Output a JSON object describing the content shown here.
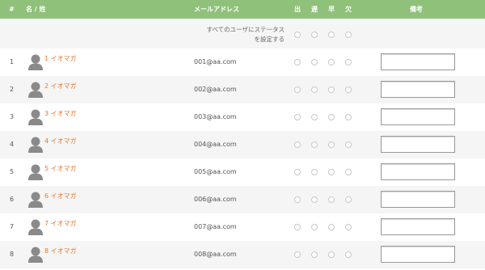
{
  "header": {
    "col_num": "#",
    "col_name": "名 / 姓",
    "col_email": "メールアドレス",
    "col_present": "出",
    "col_late": "遅",
    "col_early": "早",
    "col_absent": "欠",
    "col_note": "備考"
  },
  "bulk": {
    "label_line1": "すべてのユーザにステータス",
    "label_line2": "を設定する"
  },
  "students": [
    {
      "num": "1",
      "name": "1 イオマガ",
      "email": "001@aa.com",
      "note": ""
    },
    {
      "num": "2",
      "name": "2 イオマガ",
      "email": "002@aa.com",
      "note": ""
    },
    {
      "num": "3",
      "name": "3 イオマガ",
      "email": "003@aa.com",
      "note": ""
    },
    {
      "num": "4",
      "name": "4 イオマガ",
      "email": "004@aa.com",
      "note": ""
    },
    {
      "num": "5",
      "name": "5 イオマガ",
      "email": "005@aa.com",
      "note": ""
    },
    {
      "num": "6",
      "name": "6 イオマガ",
      "email": "006@aa.com",
      "note": ""
    },
    {
      "num": "7",
      "name": "7 イオマガ",
      "email": "007@aa.com",
      "note": ""
    },
    {
      "num": "8",
      "name": "8 イオマガ",
      "email": "008@aa.com",
      "note": ""
    }
  ],
  "colors": {
    "header_bg": "#8fc17a",
    "name_link": "#e8782f",
    "stripe": "#f5f5f5"
  },
  "icons": {
    "avatar": "user-avatar-icon"
  }
}
